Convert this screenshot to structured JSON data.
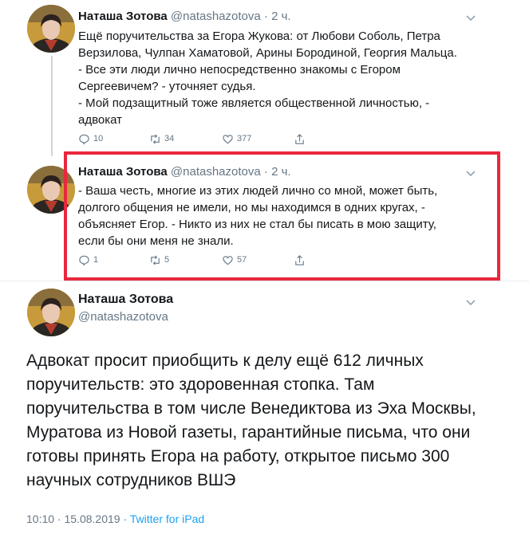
{
  "tweets": [
    {
      "name": "Наташа Зотова",
      "handle": "@natashazotova",
      "time": "2 ч.",
      "lines": [
        "Ещё поручительства за Егора Жукова: от Любови Соболь, Петра",
        "Верзилова, Чулпан Хаматовой, Арины Бородиной, Георгия Мальца.",
        "- Все эти люди лично непосредственно знакомы с Егором",
        "Сергеевичем? - уточняет судья.",
        "- Мой подзащитный тоже является общественной личностью, -",
        "адвокат"
      ],
      "replies": "10",
      "retweets": "34",
      "likes": "377"
    },
    {
      "name": "Наташа Зотова",
      "handle": "@natashazotova",
      "time": "2 ч.",
      "lines": [
        "- Ваша честь, многие из этих людей лично со мной, может быть,",
        "долгого общения не имели, но мы находимся в одних кругах, -",
        "объясняет Егор. - Никто из них не стал бы писать в мою защиту,",
        "если бы они меня не знали."
      ],
      "replies": "1",
      "retweets": "5",
      "likes": "57"
    }
  ],
  "main": {
    "name": "Наташа Зотова",
    "handle": "@natashazotova",
    "lines": [
      "Адвокат просит приобщить к делу ещё 612 личных",
      "поручительств: это здоровенная стопка. Там",
      "поручительства в том числе Венедиктова из Эха Москвы,",
      "Муратова из Новой газеты, гарантийные письма, что они",
      "готовы принять Егора на работу, открытое письмо 300",
      "научных сотрудников ВШЭ"
    ],
    "time": "10:10",
    "date": "15.08.2019",
    "source": "Twitter for iPad"
  },
  "colors": {
    "highlight": "#e8283d",
    "link": "#1da1f2",
    "muted": "#657786"
  }
}
